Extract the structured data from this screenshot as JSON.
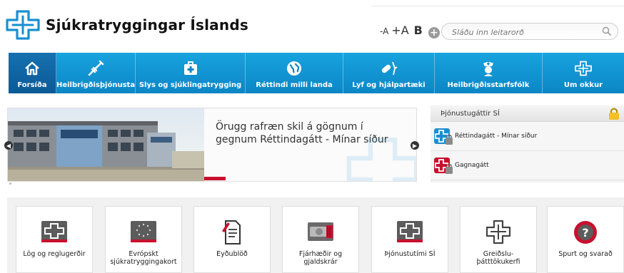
{
  "header": {
    "site_title": "Sjúkratryggingar Íslands",
    "font_small": "-A",
    "font_large": "+A",
    "font_bold": "B",
    "font_plus": "+",
    "search_placeholder": "Sláðu inn leitarorð"
  },
  "nav": {
    "items": [
      {
        "label": "Forsíða",
        "icon": "home-icon"
      },
      {
        "label": "Heilbrigðisþjónusta",
        "icon": "syringe-icon"
      },
      {
        "label": "Slys og sjúklingatrygging",
        "icon": "first-aid-icon"
      },
      {
        "label": "Réttindi milli landa",
        "icon": "globe-icon"
      },
      {
        "label": "Lyf og hjálpartæki",
        "icon": "pill-icon"
      },
      {
        "label": "Heilbrigðisstarfsfólk",
        "icon": "nurse-icon"
      },
      {
        "label": "Um okkur",
        "icon": "logo-icon"
      }
    ]
  },
  "hero": {
    "caption": "Örugg rafræn skil á gögnum í gegnum Réttindagátt - Mínar síður"
  },
  "portal": {
    "title": "Þjónustugáttir SÍ",
    "items": [
      {
        "label": "Réttindagátt - Mínar síður",
        "color": "#1a8fd0"
      },
      {
        "label": "Gagnagátt",
        "color": "#c8102e"
      }
    ]
  },
  "tiles": [
    {
      "label": "Lög og reglugerðir",
      "icon": "law-logo-icon"
    },
    {
      "label": "Evrópskt\nsjúkratryggingakort",
      "icon": "eu-card-icon"
    },
    {
      "label": "Eyðublöð",
      "icon": "form-document-icon"
    },
    {
      "label": "Fjárhæðir og\ngjaldskrár",
      "icon": "money-icon"
    },
    {
      "label": "Þjónustutími SÍ",
      "icon": "clock-logo-icon"
    },
    {
      "label": "Greiðslu-\nþátttökukerfi",
      "icon": "cross-outline-icon"
    },
    {
      "label": "Spurt og svarað",
      "icon": "question-icon"
    }
  ],
  "colors": {
    "brand_blue": "#1a8fd0",
    "nav_active": "#0b5a96",
    "accent_red": "#c8102e"
  }
}
